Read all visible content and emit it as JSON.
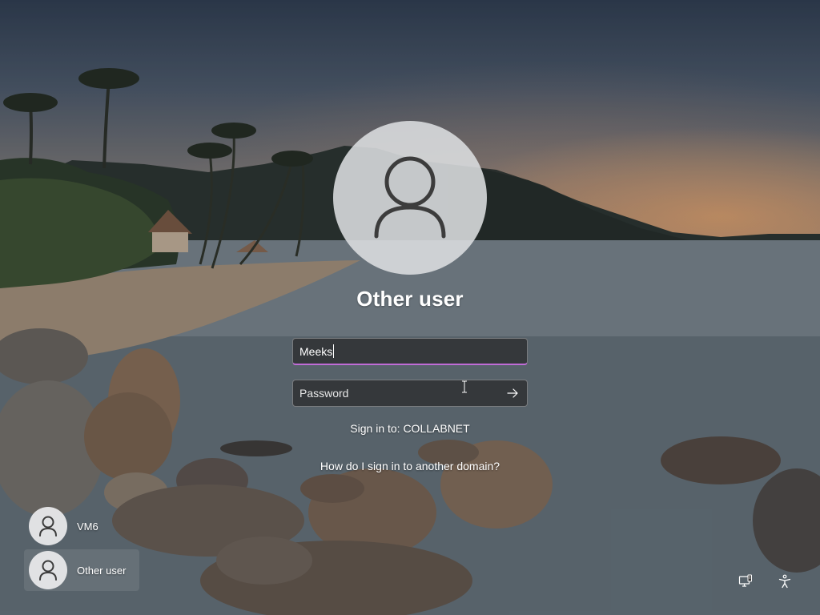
{
  "login": {
    "user_title": "Other user",
    "username_value": "Meeks",
    "password_placeholder": "Password",
    "sign_in_to": "Sign in to: COLLABNET",
    "other_domain_link": "How do I sign in to another domain?"
  },
  "users": [
    {
      "label": "VM6",
      "icon": "person-icon"
    },
    {
      "label": "Other user",
      "icon": "person-icon",
      "selected": true
    }
  ],
  "system": {
    "network_icon": "network-icon",
    "accessibility_icon": "accessibility-icon"
  },
  "colors": {
    "focus_underline": "#c06cd6",
    "field_background": "#282828",
    "text": "#ffffff"
  }
}
